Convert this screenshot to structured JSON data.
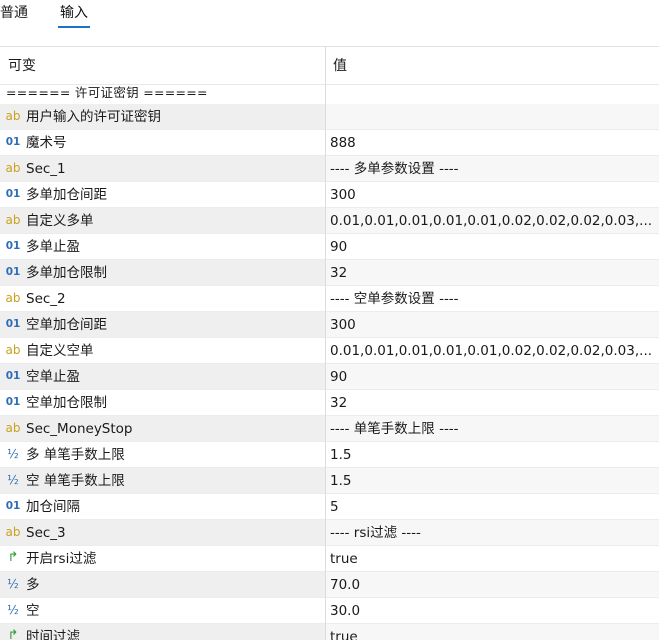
{
  "tabs": [
    {
      "label": "普通",
      "active": false
    },
    {
      "label": "输入",
      "active": true
    }
  ],
  "accent_color": "#1a73c8",
  "header": {
    "variable": "可变",
    "value": "值"
  },
  "separator": {
    "label": "====== 许可证密钥 ======"
  },
  "rows": [
    {
      "icon": "string-icon",
      "type": "ab",
      "name": "用户输入的许可证密钥",
      "value": ""
    },
    {
      "icon": "integer-icon",
      "type": "int",
      "name": "魔术号",
      "value": "888"
    },
    {
      "icon": "string-icon",
      "type": "ab",
      "name": "Sec_1",
      "value": "---- 多单参数设置 ----"
    },
    {
      "icon": "integer-icon",
      "type": "int",
      "name": "多单加仓间距",
      "value": "300"
    },
    {
      "icon": "string-icon",
      "type": "ab",
      "name": "自定义多单",
      "value": "0.01,0.01,0.01,0.01,0.01,0.02,0.02,0.02,0.03,..."
    },
    {
      "icon": "integer-icon",
      "type": "int",
      "name": "多单止盈",
      "value": "90"
    },
    {
      "icon": "integer-icon",
      "type": "int",
      "name": "多单加仓限制",
      "value": "32"
    },
    {
      "icon": "string-icon",
      "type": "ab",
      "name": "Sec_2",
      "value": "---- 空单参数设置 ----"
    },
    {
      "icon": "integer-icon",
      "type": "int",
      "name": "空单加仓间距",
      "value": "300"
    },
    {
      "icon": "string-icon",
      "type": "ab",
      "name": "自定义空单",
      "value": "0.01,0.01,0.01,0.01,0.01,0.02,0.02,0.02,0.03,..."
    },
    {
      "icon": "integer-icon",
      "type": "int",
      "name": "空单止盈",
      "value": "90"
    },
    {
      "icon": "integer-icon",
      "type": "int",
      "name": "空单加仓限制",
      "value": "32"
    },
    {
      "icon": "string-icon",
      "type": "ab",
      "name": "Sec_MoneyStop",
      "value": "---- 单笔手数上限 ----"
    },
    {
      "icon": "double-icon",
      "type": "dbl",
      "name": "多 单笔手数上限",
      "value": "1.5"
    },
    {
      "icon": "double-icon",
      "type": "dbl",
      "name": "空 单笔手数上限",
      "value": "1.5"
    },
    {
      "icon": "integer-icon",
      "type": "int",
      "name": "加仓间隔",
      "value": "5"
    },
    {
      "icon": "string-icon",
      "type": "ab",
      "name": "Sec_3",
      "value": "---- rsi过滤 ----"
    },
    {
      "icon": "bool-icon",
      "type": "bool",
      "name": "开启rsi过滤",
      "value": "true"
    },
    {
      "icon": "double-icon",
      "type": "dbl",
      "name": "多",
      "value": "70.0"
    },
    {
      "icon": "double-icon",
      "type": "dbl",
      "name": "空",
      "value": "30.0"
    },
    {
      "icon": "bool-icon",
      "type": "bool",
      "name": "时间过滤",
      "value": "true"
    }
  ],
  "icon_glyphs": {
    "ab": "ab",
    "int": "01",
    "dbl": "½",
    "bool": "↱"
  }
}
